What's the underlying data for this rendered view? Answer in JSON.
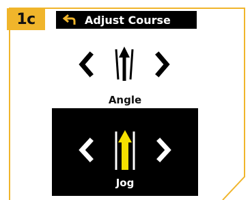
{
  "badge": {
    "label": "1c"
  },
  "header": {
    "title": "Adjust Course",
    "back_icon": "back-arrow-icon"
  },
  "angle": {
    "label": "Angle",
    "left_icon": "chevron-left-icon",
    "right_icon": "chevron-right-icon",
    "center_icon": "angle-arrow-icon"
  },
  "jog": {
    "label": "Jog",
    "left_icon": "chevron-left-icon",
    "right_icon": "chevron-right-icon",
    "center_icon": "jog-arrow-icon"
  },
  "colors": {
    "accent": "#f0b52b",
    "jog_arrow": "#f5e000",
    "panel": "#000000",
    "text_dark": "#111111",
    "text_light": "#ffffff"
  }
}
